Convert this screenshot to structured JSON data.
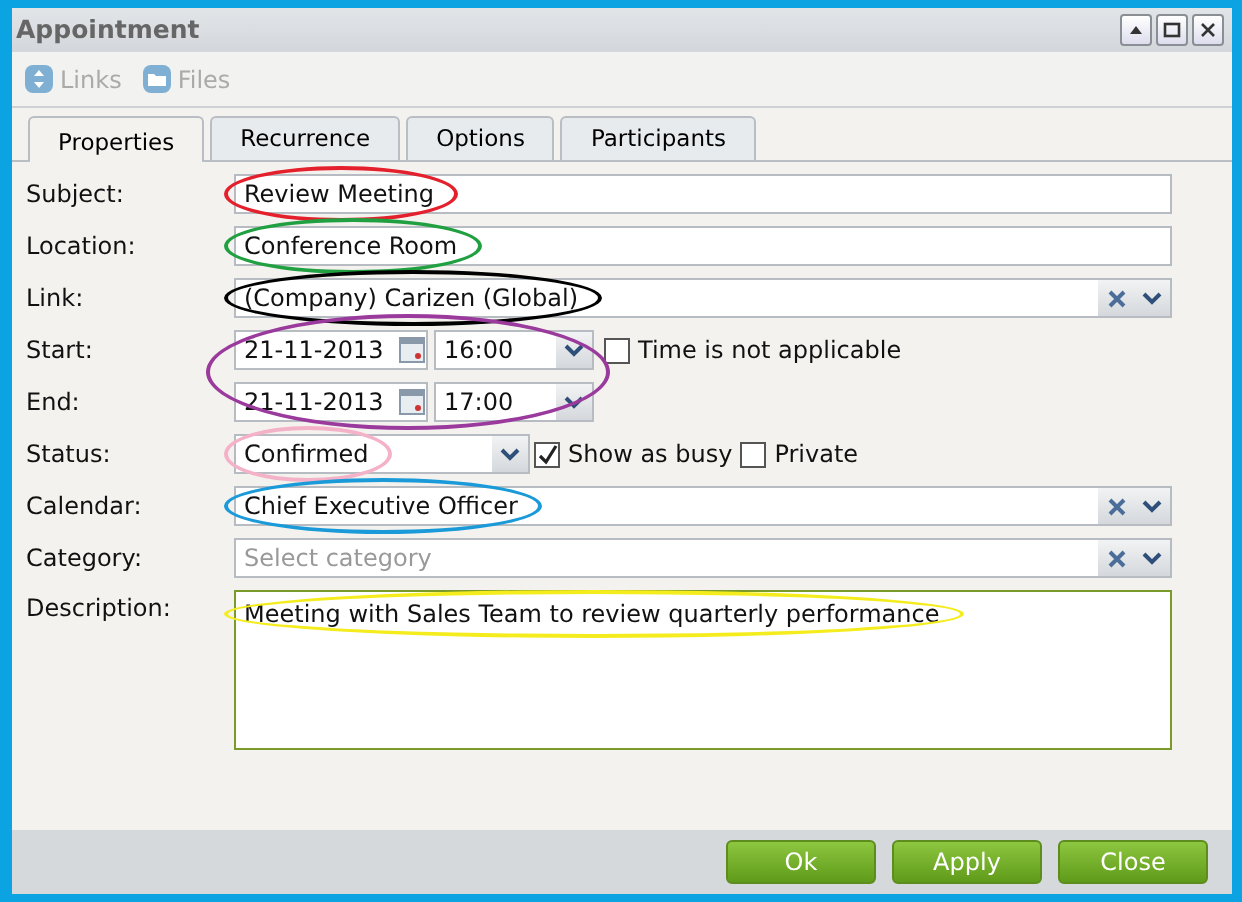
{
  "window": {
    "title": "Appointment"
  },
  "toolbar": [
    {
      "label": "Links",
      "disabled": true
    },
    {
      "label": "Files",
      "disabled": true
    }
  ],
  "tabs": [
    {
      "label": "Properties",
      "selected": true
    },
    {
      "label": "Recurrence",
      "selected": false
    },
    {
      "label": "Options",
      "selected": false
    },
    {
      "label": "Participants",
      "selected": false
    }
  ],
  "fields": [
    {
      "kind": "text",
      "label": "Subject:",
      "value": "Review Meeting",
      "annotation": {
        "color": "#e3202c"
      }
    },
    {
      "kind": "text",
      "label": "Location:",
      "value": "Conference Room",
      "annotation": {
        "color": "#20a040"
      }
    },
    {
      "kind": "combo",
      "label": "Link:",
      "value": "(Company) Carizen (Global)",
      "annotation": {
        "color": "#000000"
      }
    },
    {
      "kind": "datetime",
      "label": "Start:",
      "date": "21-11-2013",
      "time": "16:00",
      "annotation": {
        "color": "#9a3a9c"
      },
      "checkbox": {
        "label": "Time is not applicable",
        "checked": false
      }
    },
    {
      "kind": "datetime",
      "label": "End:",
      "date": "21-11-2013",
      "time": "17:00"
    },
    {
      "kind": "status",
      "label": "Status:",
      "value": "Confirmed",
      "annotation": {
        "color": "#f4b2c8"
      },
      "checkboxes": [
        {
          "label": "Show as busy",
          "checked": true
        },
        {
          "label": "Private",
          "checked": false
        }
      ]
    },
    {
      "kind": "combo",
      "label": "Calendar:",
      "value": "Chief Executive Officer",
      "annotation": {
        "color": "#1a9ad8"
      }
    },
    {
      "kind": "combo",
      "label": "Category:",
      "placeholder": "Select category"
    },
    {
      "kind": "textarea",
      "label": "Description:",
      "value": "Meeting with Sales Team to review quarterly performance",
      "annotation": {
        "color": "#f4ec1c"
      }
    }
  ],
  "buttons": [
    {
      "label": "Ok"
    },
    {
      "label": "Apply"
    },
    {
      "label": "Close"
    }
  ]
}
